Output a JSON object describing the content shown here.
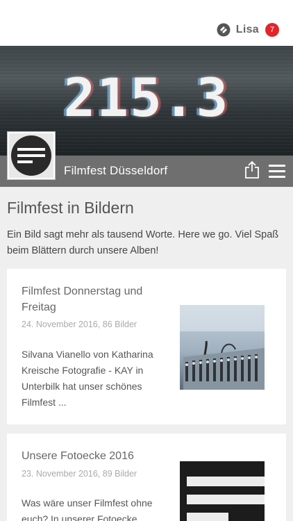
{
  "header": {
    "user_name": "Lisa",
    "notification_count": "7",
    "brand_color": "#e0262b"
  },
  "hero": {
    "text": "215.3"
  },
  "profile": {
    "name": "Filmfest Düsseldorf"
  },
  "page": {
    "title": "Filmfest in Bildern",
    "intro": "Ein Bild sagt mehr als tausend Worte. Here we go. Viel Spaß beim Blättern durch unsere Alben!"
  },
  "albums": [
    {
      "title": "Filmfest Donnerstag und Freitag",
      "meta": "24. November 2016, 86 Bilder",
      "description": "Silvana Vianello von Katharina Kreische Fotografie - KAY in Unterbilk hat unser schönes Filmfest ..."
    },
    {
      "title": "Unsere Fotoecke 2016",
      "meta": "23. November 2016, 89 Bilder",
      "description": "Was wäre unser Filmfest ohne euch? In unserer Fotoecke"
    }
  ],
  "icons": {
    "user_logo": "app-logo-icon",
    "share": "share-icon",
    "menu": "menu-icon"
  }
}
